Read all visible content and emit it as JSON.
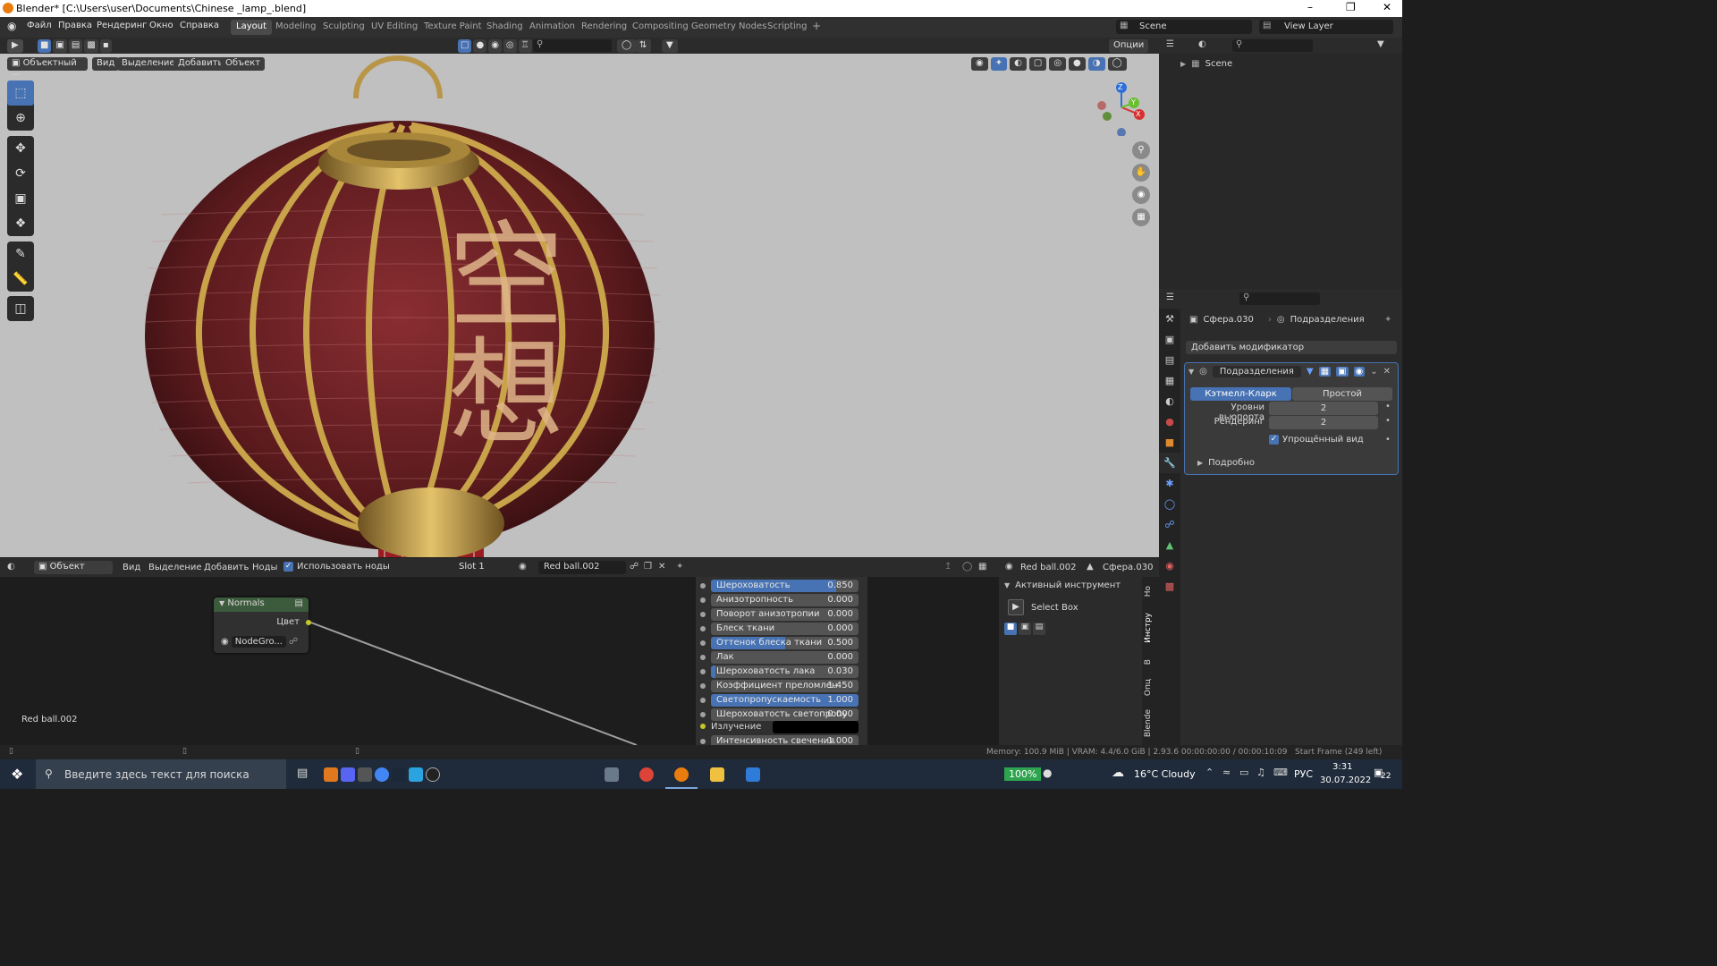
{
  "window": {
    "title": "Blender* [C:\\Users\\user\\Documents\\Chinese _lamp_.blend]"
  },
  "menubar": {
    "menus": [
      "Файл",
      "Правка",
      "Рендеринг",
      "Окно",
      "Справка"
    ],
    "workspaces": [
      "Layout",
      "Modeling",
      "Sculpting",
      "UV Editing",
      "Texture Paint",
      "Shading",
      "Animation",
      "Rendering",
      "Compositing",
      "Geometry Nodes",
      "Scripting"
    ],
    "active_workspace": "Layout",
    "add_tab": "+",
    "scene": "Scene",
    "view_layer": "View Layer"
  },
  "viewport": {
    "mode": "Объектный ...",
    "menus": [
      "Вид",
      "Выделение",
      "Добавить",
      "Объект"
    ],
    "options_label": "Опции",
    "lantern_text": "空想",
    "gizmo": {
      "x": "X",
      "y": "Y",
      "z": "Z"
    }
  },
  "outliner": {
    "root": "Scene"
  },
  "properties": {
    "object": "Сфера.030",
    "modifier_breadcrumb": "Подразделения",
    "add_modifier": "Добавить модификатор",
    "modifier": {
      "name": "Подразделения",
      "type_options": [
        "Кэтмелл-Кларк",
        "Простой"
      ],
      "active_type": "Кэтмелл-Кларк",
      "viewport_levels_label": "Уровни вьюпорта",
      "viewport_levels": "2",
      "render_label": "Рендеринг",
      "render_levels": "2",
      "optimal_display_label": "Упрощённый вид",
      "optimal_display": true,
      "advanced_label": "Подробно"
    }
  },
  "node_editor": {
    "header": {
      "type": "Объект",
      "menus": [
        "Вид",
        "Выделение",
        "Добавить",
        "Ноды"
      ],
      "use_nodes_label": "Использовать ноды",
      "slot": "Slot 1",
      "material": "Red ball.002",
      "material_right": "Red ball.002",
      "object_right": "Сфера.030"
    },
    "node": {
      "title": "Normals",
      "output": "Цвет",
      "group": "NodeGro..."
    },
    "material_label": "Red ball.002",
    "bsdf_inputs": [
      {
        "label": "Шероховатость",
        "value": "0.850",
        "fill": 0.85
      },
      {
        "label": "Анизотропность",
        "value": "0.000",
        "fill": 0
      },
      {
        "label": "Поворот анизотропии",
        "value": "0.000",
        "fill": 0
      },
      {
        "label": "Блеск ткани",
        "value": "0.000",
        "fill": 0
      },
      {
        "label": "Оттенок блеска ткани",
        "value": "0.500",
        "fill": 0.5
      },
      {
        "label": "Лак",
        "value": "0.000",
        "fill": 0
      },
      {
        "label": "Шероховатость лака",
        "value": "0.030",
        "fill": 0.03
      },
      {
        "label": "Коэффициент преломлен",
        "value": "1.450",
        "fill": 0
      },
      {
        "label": "Светопропускаемость",
        "value": "1.000",
        "fill": 1
      },
      {
        "label": "Шероховатость светопропу",
        "value": "0.000",
        "fill": 0
      }
    ],
    "emission_label": "Излучение",
    "emission_strength": {
      "label": "Интенсивность свечения",
      "value": "1.000"
    },
    "sidebar": {
      "panel_title": "Активный инструмент",
      "tool_name": "Select Box",
      "tabs": [
        "Но",
        "Инстру",
        "В",
        "Опц",
        "Blende"
      ]
    }
  },
  "statusbar": {
    "info": "Memory: 100.9 MiB | VRAM: 4.4/6.0 GiB | 2.93.6  00:00:00:00 / 00:00:10:09",
    "frame": "Start Frame (249 left)"
  },
  "taskbar": {
    "search_placeholder": "Введите здесь текст для поиска",
    "battery": "100%",
    "weather": "16°C  Cloudy",
    "language": "РУС",
    "time": "3:31",
    "date": "30.07.2022",
    "notifications": "22"
  },
  "colors": {
    "accent": "#4772b3",
    "panel": "#2b2b2b",
    "lantern_red": "#6b1f22",
    "lantern_gold": "#c9a34a"
  }
}
